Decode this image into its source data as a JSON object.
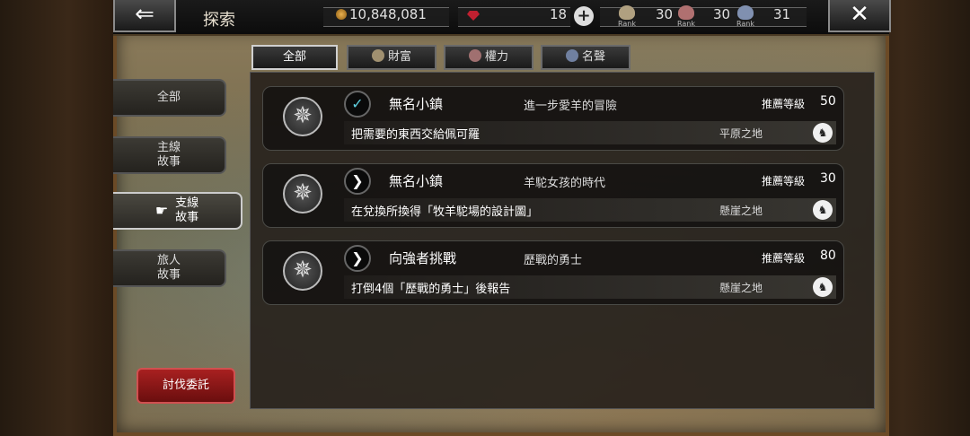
{
  "header": {
    "title": "探索",
    "gold": "10,848,081",
    "gems": "18",
    "rank_wealth": "30",
    "rank_power": "30",
    "rank_fame": "31",
    "rank_label": "Rank"
  },
  "tabs": [
    {
      "label": "全部"
    },
    {
      "label": "財富"
    },
    {
      "label": "權力"
    },
    {
      "label": "名聲"
    }
  ],
  "sidebar": {
    "items": [
      {
        "label": "全部"
      },
      {
        "label": "主線\n故事"
      },
      {
        "label": "支線\n故事"
      },
      {
        "label": "旅人\n故事"
      }
    ],
    "subjugation_label": "討伐委託"
  },
  "quests": [
    {
      "name": "無名小鎮",
      "subtitle": "進一步愛羊的冒險",
      "level_label": "推薦等級",
      "level": "50",
      "desc": "把需要的東西交給佩可羅",
      "region": "平原之地",
      "status": "completed"
    },
    {
      "name": "無名小鎮",
      "subtitle": "羊駝女孩的時代",
      "level_label": "推薦等級",
      "level": "30",
      "desc": "在兌換所換得「牧羊駝場的設計圖」",
      "region": "懸崖之地",
      "status": "available"
    },
    {
      "name": "向強者挑戰",
      "subtitle": "歷戰的勇士",
      "level_label": "推薦等級",
      "level": "80",
      "desc": "打倒4個「歷戰的勇士」後報告",
      "region": "懸崖之地",
      "status": "available"
    }
  ],
  "colors": {
    "accent_red": "#a82020",
    "check_cyan": "#5fd0e0"
  }
}
